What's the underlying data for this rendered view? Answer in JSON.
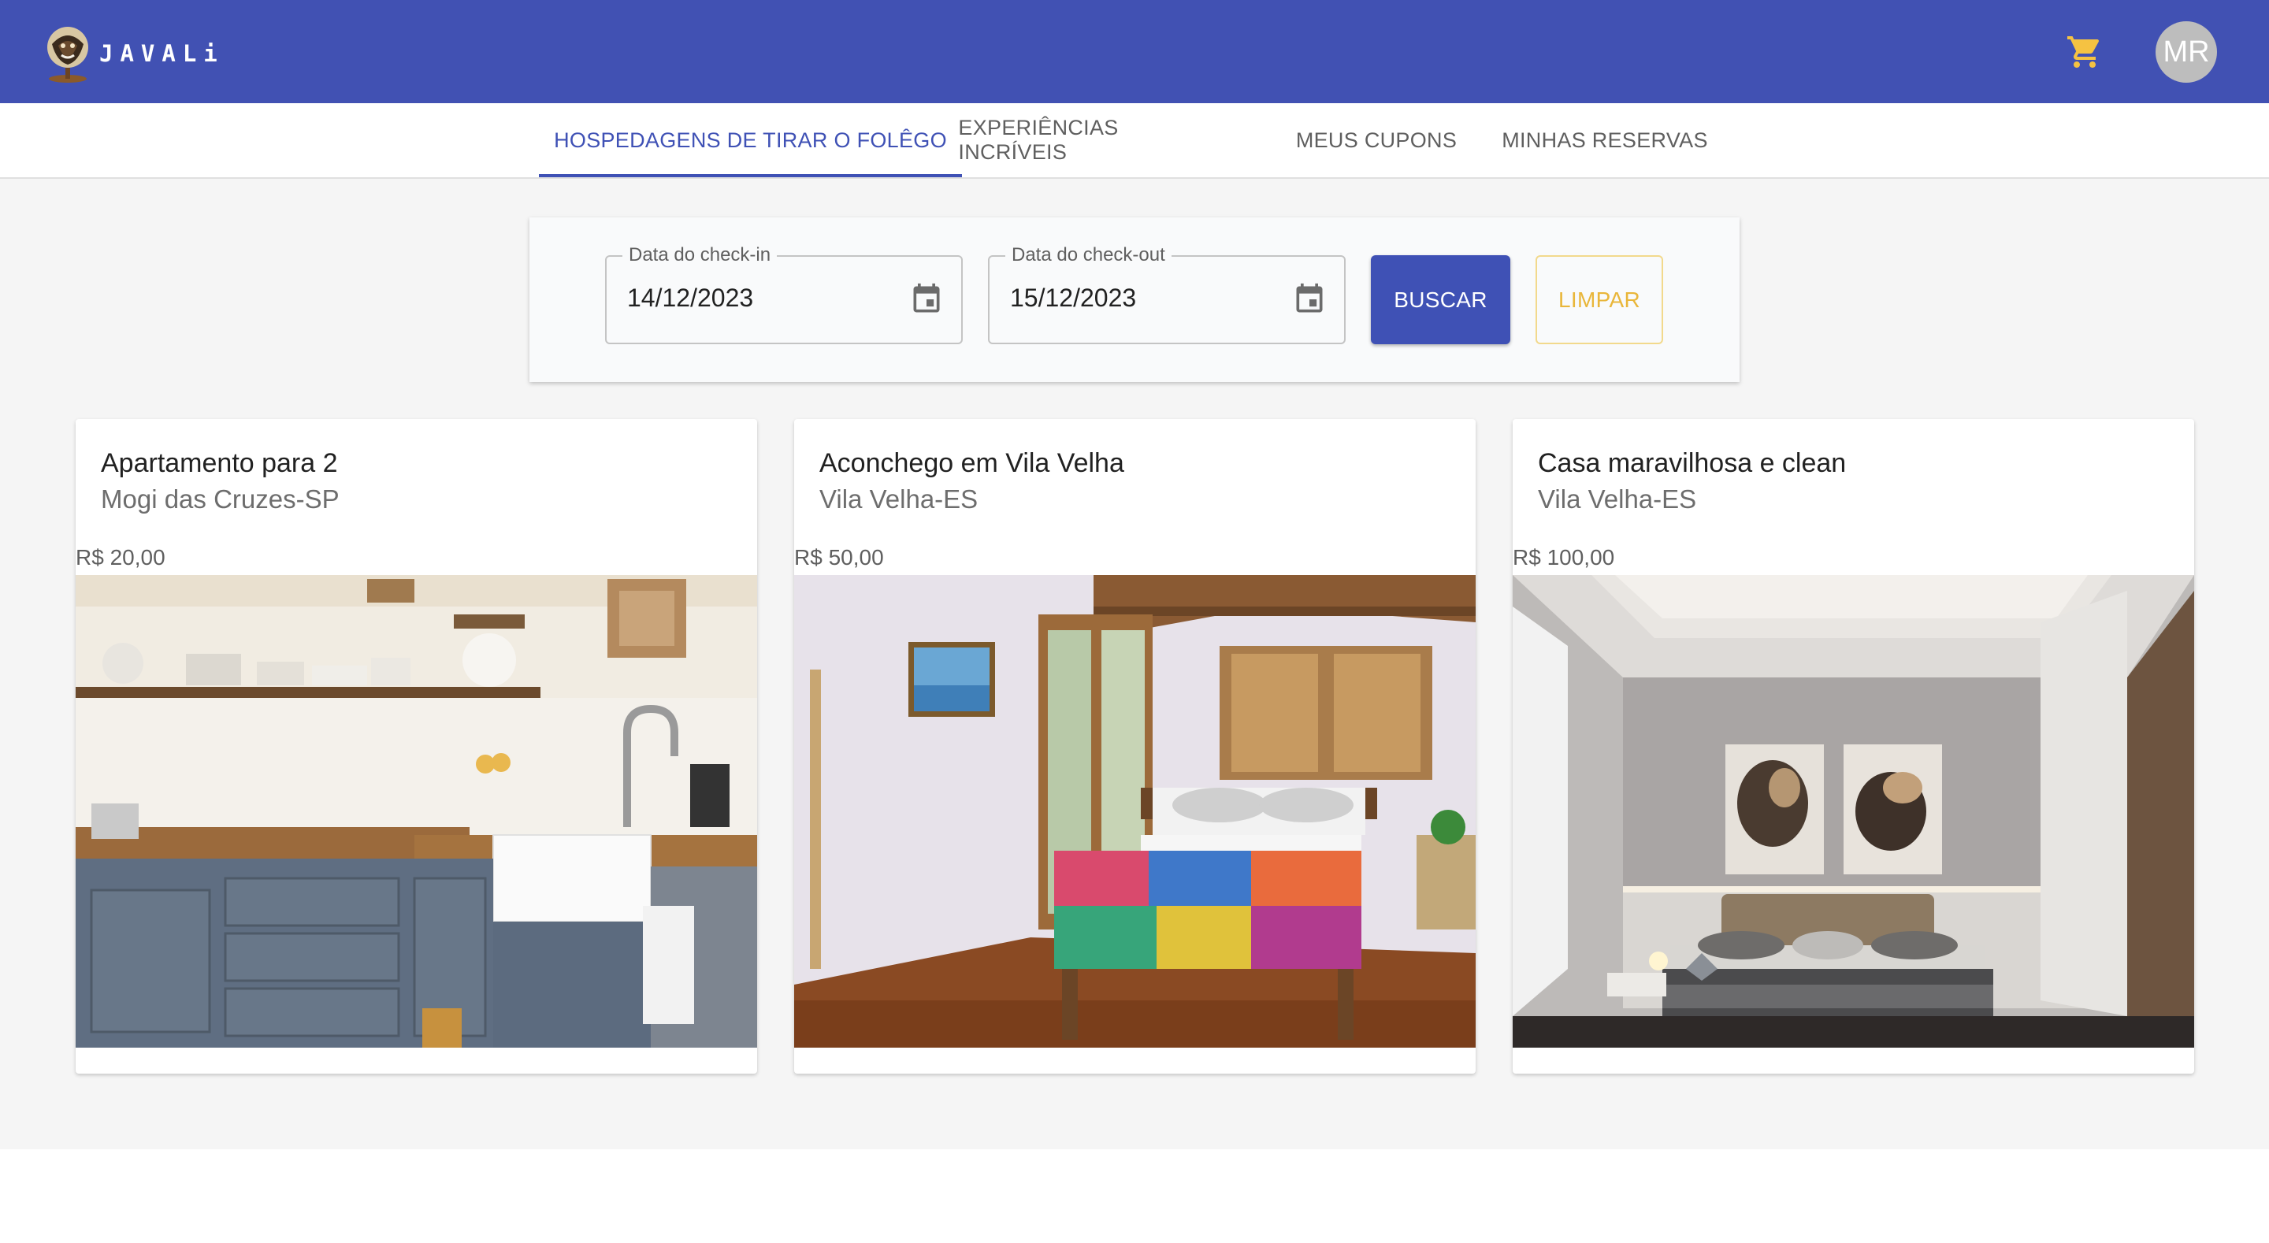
{
  "app": {
    "brand": "JAVALi",
    "cart_icon": "shopping-cart-icon",
    "avatar_initials": "MR",
    "colors": {
      "primary": "#3f51b5",
      "appbar": "#4151b3",
      "accent": "#e9b63a",
      "background": "#f5f5f5"
    }
  },
  "tabs": [
    {
      "label": "HOSPEDAGENS DE TIRAR O FOLÊGO",
      "active": true
    },
    {
      "label": "EXPERIÊNCIAS INCRÍVEIS",
      "active": false
    },
    {
      "label": "MEUS CUPONS",
      "active": false
    },
    {
      "label": "MINHAS RESERVAS",
      "active": false
    }
  ],
  "filters": {
    "checkin": {
      "label": "Data do check-in",
      "value": "14/12/2023",
      "icon": "calendar-icon"
    },
    "checkout": {
      "label": "Data do check-out",
      "value": "15/12/2023",
      "icon": "calendar-icon"
    },
    "search_label": "BUSCAR",
    "clear_label": "LIMPAR"
  },
  "listings": [
    {
      "title": "Apartamento para 2",
      "location": "Mogi das Cruzes-SP",
      "price": "R$ 20,00",
      "image": "kitchen-photo"
    },
    {
      "title": "Aconchego em Vila Velha",
      "location": "Vila Velha-ES",
      "price": "R$ 50,00",
      "image": "bedroom-photo"
    },
    {
      "title": "Casa maravilhosa e clean",
      "location": "Vila Velha-ES",
      "price": "R$ 100,00",
      "image": "modern-bedroom-photo"
    }
  ]
}
